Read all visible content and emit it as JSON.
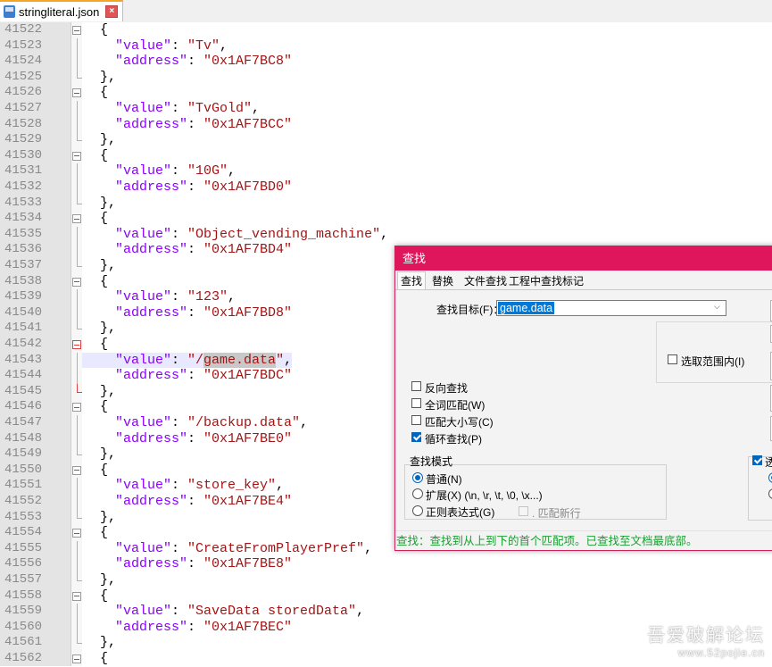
{
  "tab": {
    "title": "stringliteral.json"
  },
  "editor": {
    "lines": [
      {
        "n": "41522",
        "kind": "open"
      },
      {
        "n": "41523",
        "kind": "kv",
        "key": "value",
        "val": "Tv",
        "comma": true
      },
      {
        "n": "41524",
        "kind": "kv",
        "key": "address",
        "val": "0x1AF7BC8",
        "comma": false
      },
      {
        "n": "41525",
        "kind": "close"
      },
      {
        "n": "41526",
        "kind": "open"
      },
      {
        "n": "41527",
        "kind": "kv",
        "key": "value",
        "val": "TvGold",
        "comma": true
      },
      {
        "n": "41528",
        "kind": "kv",
        "key": "address",
        "val": "0x1AF7BCC",
        "comma": false
      },
      {
        "n": "41529",
        "kind": "close"
      },
      {
        "n": "41530",
        "kind": "open"
      },
      {
        "n": "41531",
        "kind": "kv",
        "key": "value",
        "val": "10G",
        "comma": true
      },
      {
        "n": "41532",
        "kind": "kv",
        "key": "address",
        "val": "0x1AF7BD0",
        "comma": false
      },
      {
        "n": "41533",
        "kind": "close"
      },
      {
        "n": "41534",
        "kind": "open"
      },
      {
        "n": "41535",
        "kind": "kv",
        "key": "value",
        "val": "Object_vending_machine",
        "comma": true
      },
      {
        "n": "41536",
        "kind": "kv",
        "key": "address",
        "val": "0x1AF7BD4",
        "comma": false
      },
      {
        "n": "41537",
        "kind": "close"
      },
      {
        "n": "41538",
        "kind": "open"
      },
      {
        "n": "41539",
        "kind": "kv",
        "key": "value",
        "val": "123",
        "comma": true
      },
      {
        "n": "41540",
        "kind": "kv",
        "key": "address",
        "val": "0x1AF7BD8",
        "comma": false
      },
      {
        "n": "41541",
        "kind": "close"
      },
      {
        "n": "41542",
        "kind": "open",
        "red": true
      },
      {
        "n": "41543",
        "kind": "kv",
        "key": "value",
        "val": "/game.data",
        "comma": true,
        "current": true,
        "hl_prefix": "/",
        "hl_text": "game.data"
      },
      {
        "n": "41544",
        "kind": "kv",
        "key": "address",
        "val": "0x1AF7BDC",
        "comma": false
      },
      {
        "n": "41545",
        "kind": "close",
        "red": true
      },
      {
        "n": "41546",
        "kind": "open"
      },
      {
        "n": "41547",
        "kind": "kv",
        "key": "value",
        "val": "/backup.data",
        "comma": true
      },
      {
        "n": "41548",
        "kind": "kv",
        "key": "address",
        "val": "0x1AF7BE0",
        "comma": false
      },
      {
        "n": "41549",
        "kind": "close"
      },
      {
        "n": "41550",
        "kind": "open"
      },
      {
        "n": "41551",
        "kind": "kv",
        "key": "value",
        "val": "store_key",
        "comma": true
      },
      {
        "n": "41552",
        "kind": "kv",
        "key": "address",
        "val": "0x1AF7BE4",
        "comma": false
      },
      {
        "n": "41553",
        "kind": "close"
      },
      {
        "n": "41554",
        "kind": "open"
      },
      {
        "n": "41555",
        "kind": "kv",
        "key": "value",
        "val": "CreateFromPlayerPref",
        "comma": true
      },
      {
        "n": "41556",
        "kind": "kv",
        "key": "address",
        "val": "0x1AF7BE8",
        "comma": false
      },
      {
        "n": "41557",
        "kind": "close"
      },
      {
        "n": "41558",
        "kind": "open"
      },
      {
        "n": "41559",
        "kind": "kv",
        "key": "value",
        "val": "SaveData storedData",
        "comma": true
      },
      {
        "n": "41560",
        "kind": "kv",
        "key": "address",
        "val": "0x1AF7BEC",
        "comma": false
      },
      {
        "n": "41561",
        "kind": "close"
      },
      {
        "n": "41562",
        "kind": "open"
      }
    ]
  },
  "dialog": {
    "title": "查找",
    "tabs": [
      "查找",
      "替换",
      "文件查找",
      "工程中查找",
      "标记"
    ],
    "target_label": "查找目标(F)：",
    "target_value": "game.data",
    "in_selection_label": "选取范围内(I)",
    "options": {
      "backward": {
        "label": "反向查找",
        "checked": false
      },
      "whole_word": {
        "label": "全词匹配(W)",
        "checked": false
      },
      "match_case": {
        "label": "匹配大小写(C)",
        "checked": false
      },
      "wrap": {
        "label": "循环查找(P)",
        "checked": true
      }
    },
    "mode": {
      "title": "查找模式",
      "normal": "普通(N)",
      "extended": "扩展(X) (\\n, \\r, \\t, \\0, \\x...)",
      "regex": "正则表达式(G)",
      "dot_newline": ". 匹配新行",
      "selected": "normal"
    },
    "transparency_label": "透",
    "status": "查找：查找到从上到下的首个匹配项。已查找至文档最底部。"
  },
  "watermark": {
    "line1": "吾爱破解论坛",
    "line2": "www.52pojie.cn"
  },
  "colors": {
    "title_bar": "#e0165c",
    "status_text": "#18a030",
    "key": "#8b00ff",
    "string": "#a31515"
  }
}
